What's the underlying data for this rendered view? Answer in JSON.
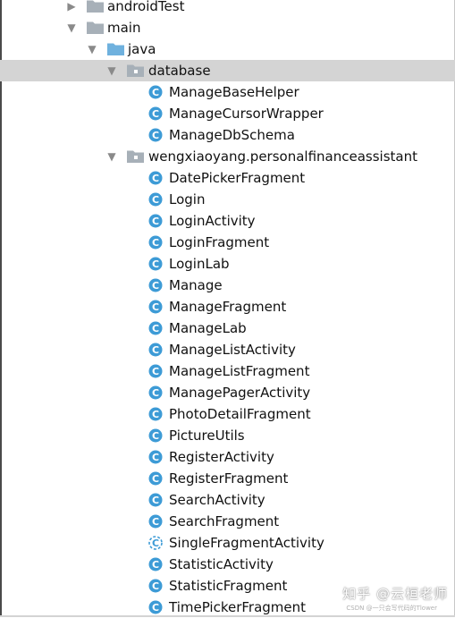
{
  "tree": [
    {
      "label": "androidTest",
      "kind": "folder",
      "depth": 0,
      "expanded": false,
      "arrow_icon": "chevron-right-icon",
      "icon": "folder-icon",
      "selected": false
    },
    {
      "label": "main",
      "kind": "folder",
      "depth": 0,
      "expanded": true,
      "arrow_icon": "chevron-down-icon",
      "icon": "folder-icon",
      "selected": false
    },
    {
      "label": "java",
      "kind": "source-folder",
      "depth": 1,
      "expanded": true,
      "arrow_icon": "chevron-down-icon",
      "icon": "source-folder-icon",
      "selected": false
    },
    {
      "label": "database",
      "kind": "package",
      "depth": 2,
      "expanded": true,
      "arrow_icon": "chevron-down-icon",
      "icon": "package-icon",
      "selected": true
    },
    {
      "label": "ManageBaseHelper",
      "kind": "class",
      "depth": 3,
      "icon": "java-class-icon"
    },
    {
      "label": "ManageCursorWrapper",
      "kind": "class",
      "depth": 3,
      "icon": "java-class-icon"
    },
    {
      "label": "ManageDbSchema",
      "kind": "class",
      "depth": 3,
      "icon": "java-class-icon"
    },
    {
      "label": "wengxiaoyang.personalfinanceassistant",
      "kind": "package",
      "depth": 2,
      "expanded": true,
      "arrow_icon": "chevron-down-icon",
      "icon": "package-icon",
      "selected": false
    },
    {
      "label": "DatePickerFragment",
      "kind": "class",
      "depth": 3,
      "icon": "java-class-icon"
    },
    {
      "label": "Login",
      "kind": "class",
      "depth": 3,
      "icon": "java-class-icon"
    },
    {
      "label": "LoginActivity",
      "kind": "class",
      "depth": 3,
      "icon": "java-class-icon"
    },
    {
      "label": "LoginFragment",
      "kind": "class",
      "depth": 3,
      "icon": "java-class-icon"
    },
    {
      "label": "LoginLab",
      "kind": "class",
      "depth": 3,
      "icon": "java-class-icon"
    },
    {
      "label": "Manage",
      "kind": "class",
      "depth": 3,
      "icon": "java-class-icon"
    },
    {
      "label": "ManageFragment",
      "kind": "class",
      "depth": 3,
      "icon": "java-class-icon"
    },
    {
      "label": "ManageLab",
      "kind": "class",
      "depth": 3,
      "icon": "java-class-icon"
    },
    {
      "label": "ManageListActivity",
      "kind": "class",
      "depth": 3,
      "icon": "java-class-icon"
    },
    {
      "label": "ManageListFragment",
      "kind": "class",
      "depth": 3,
      "icon": "java-class-icon"
    },
    {
      "label": "ManagePagerActivity",
      "kind": "class",
      "depth": 3,
      "icon": "java-class-icon"
    },
    {
      "label": "PhotoDetailFragment",
      "kind": "class",
      "depth": 3,
      "icon": "java-class-icon"
    },
    {
      "label": "PictureUtils",
      "kind": "class",
      "depth": 3,
      "icon": "java-class-icon"
    },
    {
      "label": "RegisterActivity",
      "kind": "class",
      "depth": 3,
      "icon": "java-class-icon"
    },
    {
      "label": "RegisterFragment",
      "kind": "class",
      "depth": 3,
      "icon": "java-class-icon"
    },
    {
      "label": "SearchActivity",
      "kind": "class",
      "depth": 3,
      "icon": "java-class-icon"
    },
    {
      "label": "SearchFragment",
      "kind": "class",
      "depth": 3,
      "icon": "java-class-icon"
    },
    {
      "label": "SingleFragmentActivity",
      "kind": "class",
      "depth": 3,
      "icon": "java-abstract-class-icon"
    },
    {
      "label": "StatisticActivity",
      "kind": "class",
      "depth": 3,
      "icon": "java-class-icon"
    },
    {
      "label": "StatisticFragment",
      "kind": "class",
      "depth": 3,
      "icon": "java-class-icon"
    },
    {
      "label": "TimePickerFragment",
      "kind": "class",
      "depth": 3,
      "icon": "java-class-icon"
    }
  ],
  "colors": {
    "selection": "#d4d4d4",
    "folder": "#a7b0b8",
    "source_folder": "#6fb1de",
    "class_icon": "#3d9bd6",
    "arrow": "#8a8a8a",
    "text": "#111111"
  },
  "watermark": {
    "text": "知乎 @云桓老师",
    "small": "CSDN @一只会写代码的Tlower"
  }
}
